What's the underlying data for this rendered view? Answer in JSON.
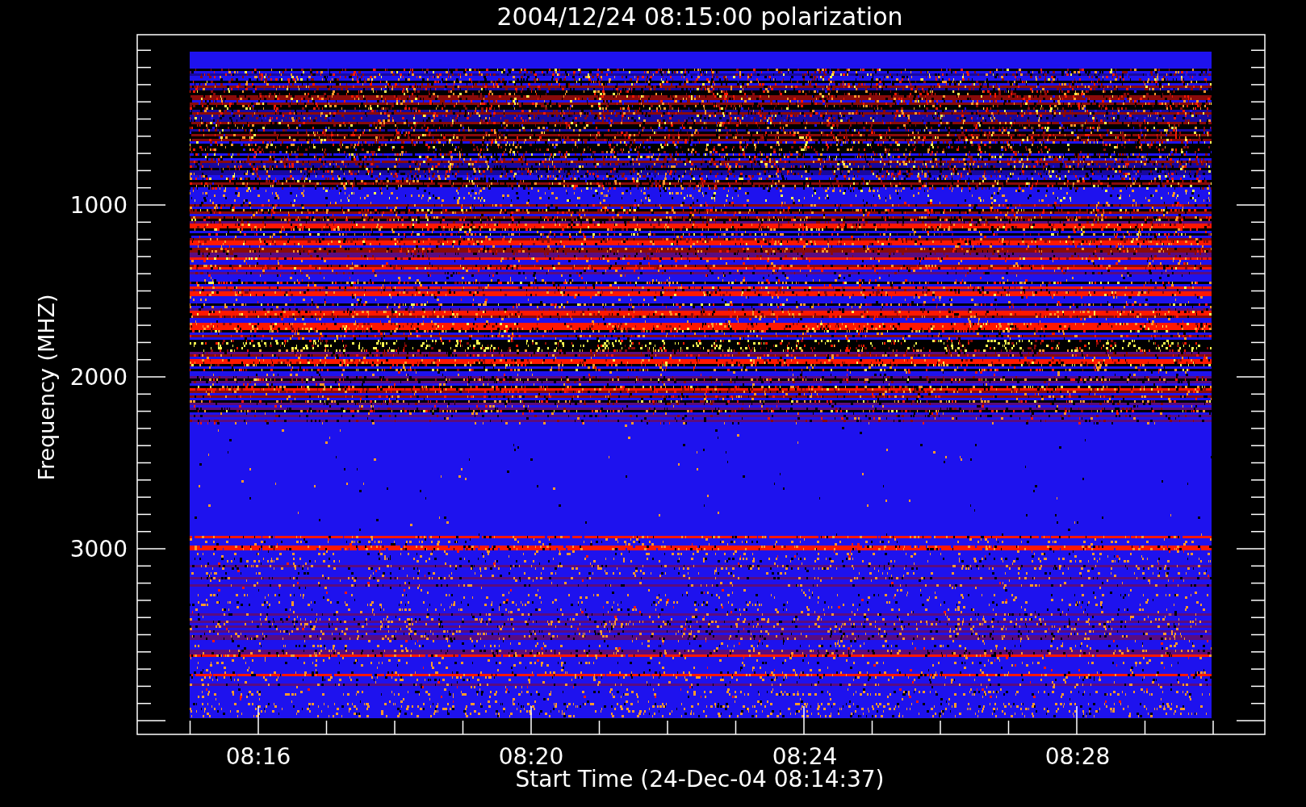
{
  "title": "2004/12/24 08:15:00 polarization",
  "y_axis": {
    "label": "Frequency (MHZ)",
    "tick_labels": [
      "1000",
      "2000",
      "3000"
    ]
  },
  "x_axis": {
    "label": "Start Time (24-Dec-04 08:14:37)",
    "tick_labels": [
      "08:16",
      "08:20",
      "08:24",
      "08:28"
    ]
  }
}
